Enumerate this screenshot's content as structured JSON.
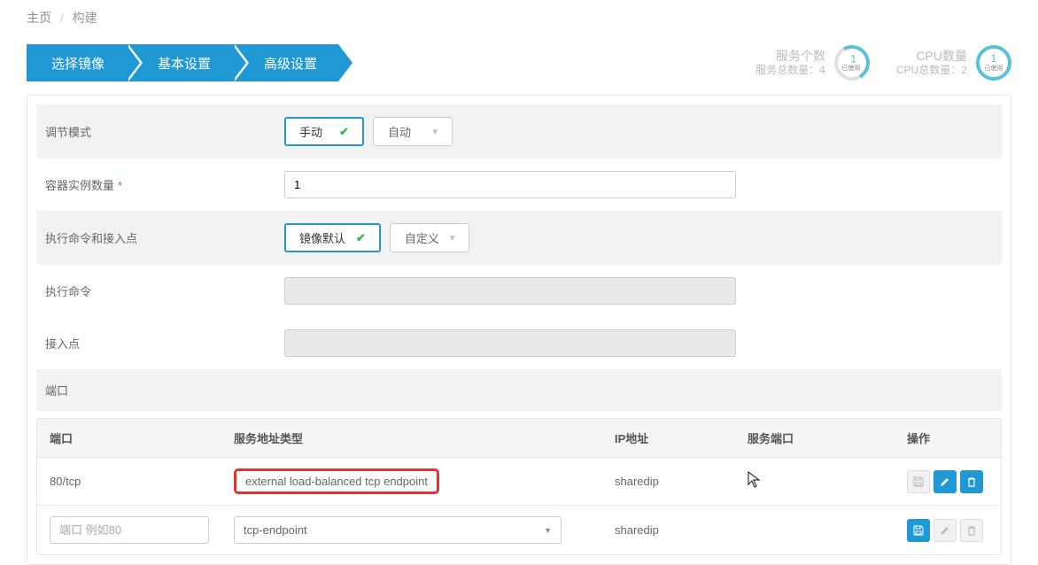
{
  "breadcrumb": {
    "home": "主页",
    "current": "构建"
  },
  "steps": [
    "选择镜像",
    "基本设置",
    "高级设置"
  ],
  "stats": {
    "service": {
      "title": "服务个数",
      "sub": "服务总数量：4",
      "badge_num": "1",
      "badge_label": "已使用"
    },
    "cpu": {
      "title": "CPU数量",
      "sub": "CPU总数量：2",
      "badge_num": "1",
      "badge_label": "已使用"
    }
  },
  "form": {
    "mode_label": "调节模式",
    "mode_manual": "手动",
    "mode_auto": "自动",
    "instances_label": "容器实例数量",
    "instances_value": "1",
    "cmd_entry_label": "执行命令和接入点",
    "default_image": "镜像默认",
    "custom": "自定义",
    "cmd_label": "执行命令",
    "entry_label": "接入点",
    "ports_section": "端口"
  },
  "table": {
    "headers": {
      "port": "端口",
      "addr": "服务地址类型",
      "ip": "IP地址",
      "sport": "服务端口",
      "act": "操作"
    },
    "rows": [
      {
        "port": "80/tcp",
        "addr": "external load-balanced tcp endpoint",
        "ip": "sharedip",
        "sport": "",
        "highlight": true
      },
      {
        "port_placeholder": "端口 例如80",
        "addr_select": "tcp-endpoint",
        "ip": "sharedip",
        "sport": "",
        "new": true
      }
    ]
  }
}
